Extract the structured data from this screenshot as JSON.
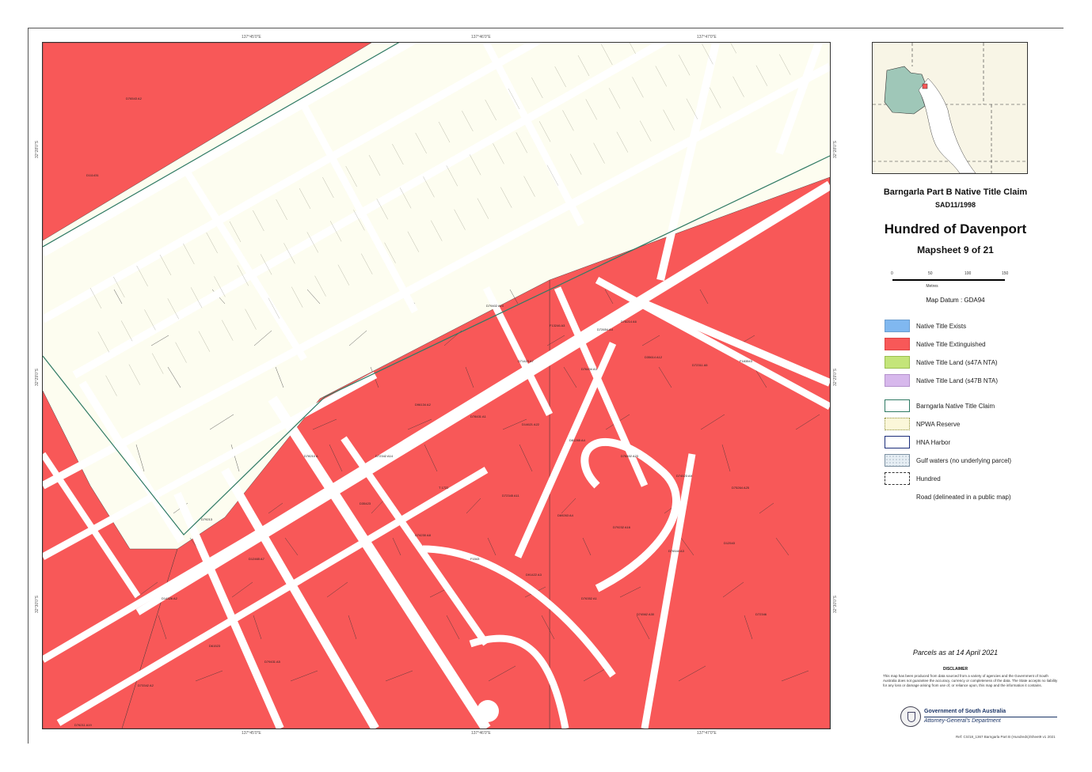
{
  "header": {
    "claim_name": "Barngarla Part B Native Title Claim",
    "claim_id": "SAD11/1998",
    "title": "Hundred of Davenport",
    "subtitle": "Mapsheet 9 of 21"
  },
  "scale_bar": {
    "ticks": [
      "0",
      "50",
      "100",
      "150"
    ],
    "unit": "Metres"
  },
  "map_datum": "Map Datum : GDA94",
  "legend": [
    {
      "label": "Native Title Exists",
      "fill": "#80b8f0",
      "stroke": "#6c9ecf",
      "style": "solid"
    },
    {
      "label": "Native Title Extinguished",
      "fill": "#f85858",
      "stroke": "#d44",
      "style": "solid"
    },
    {
      "label": "Native Title Land (s47A NTA)",
      "fill": "#c4e57a",
      "stroke": "#9bbf52",
      "style": "solid"
    },
    {
      "label": "Native Title Land (s47B NTA)",
      "fill": "#d7b8ec",
      "stroke": "#b592cc",
      "style": "solid"
    },
    {
      "label": "Barngarla Native Title Claim",
      "fill": "#ffffff",
      "stroke": "#2f7a64",
      "style": "outline"
    },
    {
      "label": "NPWA Reserve",
      "fill": "#fbf7d9",
      "stroke": "#8d8f3a",
      "style": "dotted"
    },
    {
      "label": "HNA Harbor",
      "fill": "#ffffff",
      "stroke": "#1c2e7a",
      "style": "outline"
    },
    {
      "label": "Gulf waters (no underlying parcel)",
      "fill": "#e6eef4",
      "stroke": "#7b8fa0",
      "style": "speckled"
    },
    {
      "label": "Hundred",
      "fill": "#ffffff",
      "stroke": "#333333",
      "style": "dashed"
    },
    {
      "label": "Road (delineated in a public map)",
      "fill": "#ffffff",
      "stroke": "#ffffff",
      "style": "none"
    }
  ],
  "parcels_date": "Parcels as at 14 April 2021",
  "disclaimer": {
    "title": "DISCLAIMER",
    "text": "This map has been produced from data sourced from a variety of agencies and the Government of South Australia does not guarantee the accuracy, currency or completeness of the data. The State accepts no liability for any loss or damage arising from use of, or reliance upon, this map and the information it contains."
  },
  "government": {
    "name": "Government of South Australia",
    "department": "Attorney-General's Department"
  },
  "footer_ref": "Ref: CS/18_1367 Barngarla Part B (Hundreds)/Sheet9 v1 2021",
  "grid_labels": {
    "top": [
      "137°45'0\"E",
      "137°46'0\"E",
      "137°47'0\"E"
    ],
    "bottom": [
      "137°45'0\"E",
      "137°46'0\"E",
      "137°47'0\"E"
    ],
    "left": [
      "32°28'0\"S",
      "32°29'0\"S",
      "32°30'0\"S"
    ],
    "right": [
      "32°28'0\"S",
      "32°29'0\"S",
      "32°30'0\"S"
    ]
  },
  "parcel_labels": [
    "D76543 A2",
    "D111431",
    "D79402 A10",
    "F13246 A3",
    "D72654 A4",
    "D78214 A6",
    "D71423 A7",
    "D76434 A3",
    "D35614 A12",
    "D72311 A5",
    "F183543",
    "D96134 A2",
    "D78431 A1",
    "D14621 A22",
    "D81265 A4",
    "D76402 A23",
    "D74523 A9",
    "D75264 A25",
    "D72342 A14",
    "T 1722",
    "D72345 A11",
    "D69263 A4",
    "D79232 A16",
    "D76544 A3",
    "D12543",
    "D78210 A",
    "D35423",
    "D74230 A8",
    "F1543",
    "D91422 A3",
    "D76352 A1",
    "D74562 A30",
    "D79213",
    "D12465 A7",
    "D14326 A2",
    "D61523",
    "D79431 A5",
    "D73342 A2",
    "D76211 A19",
    "D72346"
  ],
  "colors": {
    "extinguished": "#f85858",
    "road": "#ffffff",
    "unclaimed": "#fdfdf0",
    "parcel_line": "#222222",
    "claim_boundary": "#2f7a64"
  }
}
